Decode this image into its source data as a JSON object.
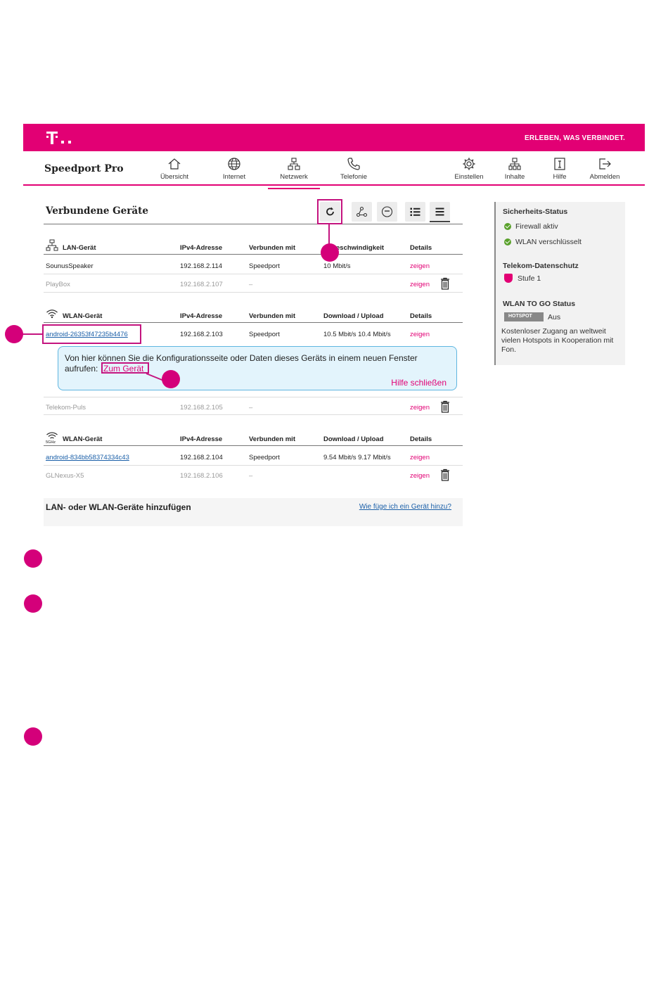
{
  "header": {
    "slogan": "ERLEBEN, WAS VERBINDET.",
    "brand": "Speedport Pro"
  },
  "nav": {
    "items": [
      {
        "label": "Übersicht",
        "icon": "home-icon"
      },
      {
        "label": "Internet",
        "icon": "globe-icon"
      },
      {
        "label": "Netzwerk",
        "icon": "network-icon",
        "active": true
      },
      {
        "label": "Telefonie",
        "icon": "phone-icon"
      },
      {
        "label": "Einstellen",
        "icon": "gear-icon"
      },
      {
        "label": "Inhalte",
        "icon": "content-icon"
      },
      {
        "label": "Hilfe",
        "icon": "help-icon"
      },
      {
        "label": "Abmelden",
        "icon": "logout-icon"
      }
    ]
  },
  "main": {
    "title": "Verbundene Geräte",
    "lan": {
      "headers": [
        "LAN-Gerät",
        "IPv4-Adresse",
        "Verbunden mit",
        "Geschwindigkeit",
        "Details"
      ],
      "headers_visible_speed": "eschwindigkeit",
      "rows": [
        {
          "name": "SounusSpeaker",
          "ip": "192.168.2.114",
          "conn": "Speedport",
          "speed": "10 Mbit/s",
          "details": "zeigen"
        },
        {
          "name": "PlayBox",
          "ip": "192.168.2.107",
          "conn": "–",
          "speed": "",
          "details": "zeigen"
        }
      ]
    },
    "wlan24": {
      "headers": [
        "WLAN-Gerät",
        "IPv4-Adresse",
        "Verbunden mit",
        "Download / Upload",
        "Details"
      ],
      "rows": [
        {
          "name": "android-26353f47235b4476",
          "ip": "192.168.2.103",
          "conn": "Speedport",
          "speed": "10.5 Mbit/s 10.4 Mbit/s",
          "details": "zeigen"
        },
        {
          "name": "Telekom-Puls",
          "ip": "192.168.2.105",
          "conn": "–",
          "speed": "",
          "details": "zeigen"
        }
      ]
    },
    "help": {
      "line1": "Von hier können Sie die Konfigurationsseite oder Daten dieses Geräts in einem neuen Fenster",
      "line2": "aufrufen:",
      "link": "Zum Gerät",
      "close": "Hilfe schließen"
    },
    "wlan5": {
      "band": "5GHz",
      "headers": [
        "WLAN-Gerät",
        "IPv4-Adresse",
        "Verbunden mit",
        "Download / Upload",
        "Details"
      ],
      "rows": [
        {
          "name": "android-834bb58374334c43",
          "ip": "192.168.2.104",
          "conn": "Speedport",
          "speed": "9.54 Mbit/s 9.17 Mbit/s",
          "details": "zeigen"
        },
        {
          "name": "GLNexus-X5",
          "ip": "192.168.2.106",
          "conn": "–",
          "speed": "",
          "details": "zeigen"
        }
      ]
    },
    "add": {
      "title": "LAN- oder WLAN-Geräte hinzufügen",
      "link": "Wie füge ich ein Gerät hinzu?"
    }
  },
  "side": {
    "security_title": "Sicherheits-Status",
    "firewall": "Firewall aktiv",
    "wlan": "WLAN verschlüsselt",
    "privacy_title": "Telekom-Datenschutz",
    "privacy_level": "Stufe 1",
    "togo_title": "WLAN TO GO Status",
    "hotspot_badge": "HOTSPOT",
    "togo_state": "Aus",
    "togo_desc": "Kostenloser Zugang an weltweit vielen Hotspots in Kooperation mit Fon."
  },
  "colors": {
    "brand": "#e20074",
    "annotation": "#c4147f",
    "link": "#1a5fa8",
    "ok": "#5aa12c"
  }
}
